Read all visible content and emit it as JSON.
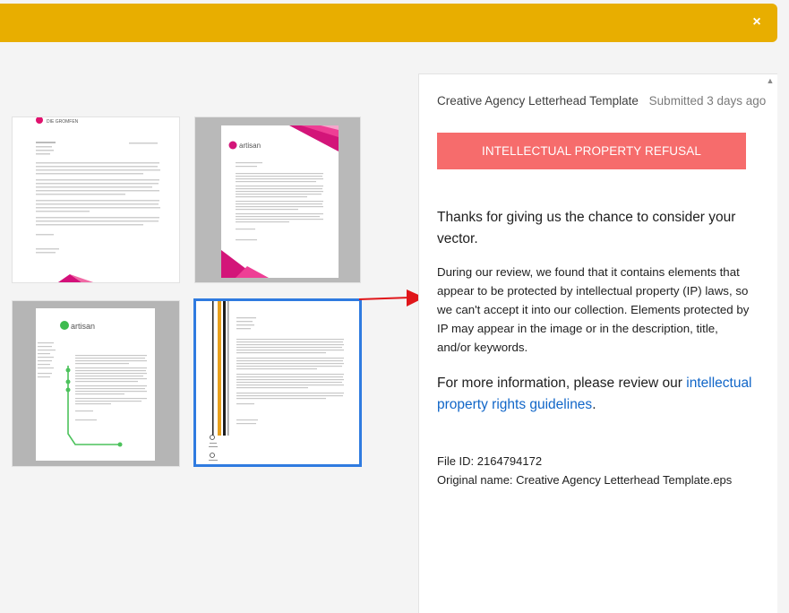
{
  "banner": {
    "close_glyph": "×",
    "color": "#e8ae00"
  },
  "thumbnails": [
    {
      "logo_text": "DIE GROMFEN",
      "selected": false
    },
    {
      "logo_text": "artisan",
      "selected": false
    },
    {
      "logo_text": "artisan",
      "selected": false
    },
    {
      "logo_text": "",
      "selected": true
    }
  ],
  "panel": {
    "asset_title": "Creative Agency Letterhead Template",
    "submitted": "Submitted 3 days ago",
    "status_label": "INTELLECTUAL PROPERTY REFUSAL",
    "status_color": "#f66c6c",
    "thanks": "Thanks for giving us the chance to consider your vector.",
    "review": "During our review, we found that it contains elements that appear to be protected by intellectual property (IP) laws, so we can't accept it into our collection. Elements protected by IP may appear in the image or in the description, title, and/or keywords.",
    "more_prefix": "For more information, please review our ",
    "more_link": "intellectual property rights guidelines",
    "more_suffix": ".",
    "file_id": "File ID: 2164794172",
    "original_name": "Original name: Creative Agency Letterhead Template.eps"
  },
  "icons": {
    "close": "close-icon",
    "scroll_up": "scroll-up-icon",
    "arrow": "red-arrow-icon"
  }
}
